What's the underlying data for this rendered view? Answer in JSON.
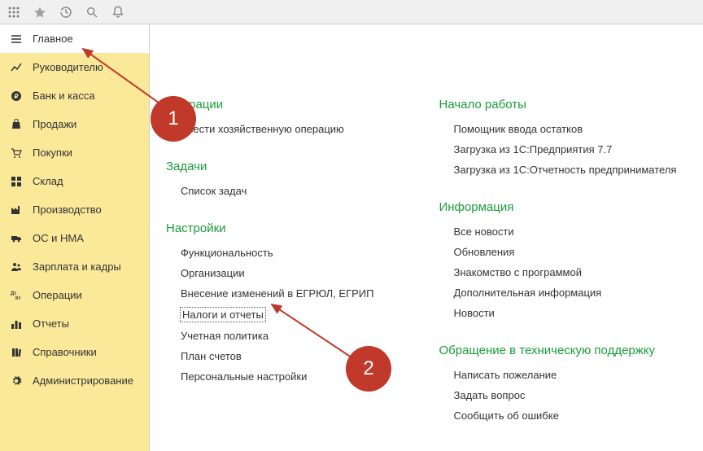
{
  "sidebar": {
    "items": [
      {
        "label": "Главное",
        "active": true
      },
      {
        "label": "Руководителю"
      },
      {
        "label": "Банк и касса"
      },
      {
        "label": "Продажи"
      },
      {
        "label": "Покупки"
      },
      {
        "label": "Склад"
      },
      {
        "label": "Производство"
      },
      {
        "label": "ОС и НМА"
      },
      {
        "label": "Зарплата и кадры"
      },
      {
        "label": "Операции"
      },
      {
        "label": "Отчеты"
      },
      {
        "label": "Справочники"
      },
      {
        "label": "Администрирование"
      }
    ]
  },
  "content": {
    "left": [
      {
        "title": "Операции",
        "links": [
          "Ввести хозяйственную операцию"
        ]
      },
      {
        "title": "Задачи",
        "links": [
          "Список задач"
        ]
      },
      {
        "title": "Настройки",
        "links": [
          "Функциональность",
          "Организации",
          "Внесение изменений в ЕГРЮЛ, ЕГРИП",
          "Налоги и отчеты",
          "Учетная политика",
          "План счетов",
          "Персональные настройки"
        ]
      }
    ],
    "right": [
      {
        "title": "Начало работы",
        "links": [
          "Помощник ввода остатков",
          "Загрузка из 1С:Предприятия 7.7",
          "Загрузка из 1С:Отчетность предпринимателя"
        ]
      },
      {
        "title": "Информация",
        "links": [
          "Все новости",
          "Обновления",
          "Знакомство с программой",
          "Дополнительная информация",
          "Новости"
        ]
      },
      {
        "title": "Обращение в техническую поддержку",
        "links": [
          "Написать пожелание",
          "Задать вопрос",
          "Сообщить об ошибке"
        ]
      }
    ]
  },
  "annotations": {
    "circle1": "1",
    "circle2": "2"
  }
}
